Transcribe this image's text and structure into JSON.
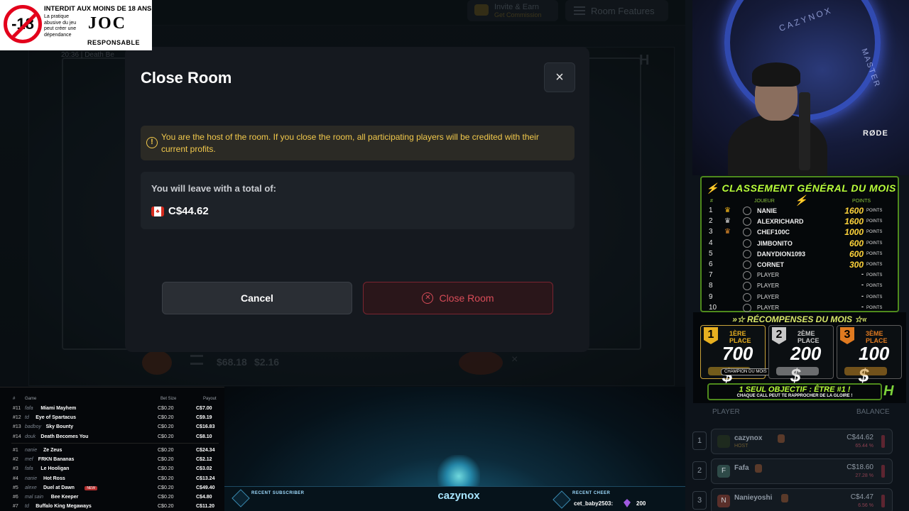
{
  "topbar": {
    "invite_label": "Invite & Earn",
    "invite_sub": "Get Commission",
    "features_label": "Room Features"
  },
  "game": {
    "time": "20:36",
    "title_partial": "Death Be",
    "balance": "$68.18",
    "bet": "$2.16"
  },
  "modal": {
    "title": "Close Room",
    "close_glyph": "×",
    "warning": "You are the host of the room. If you close the room, all participating players will be credited with their current profits.",
    "total_label": "You will leave with a total of:",
    "total_value": "C$44.62",
    "cancel_label": "Cancel",
    "confirm_label": "Close Room"
  },
  "age_banner": {
    "title": "INTERDIT AUX MOINS DE 18 ANS",
    "badge": "-18",
    "desc": "La pratique abusive du jeu peut créer une dépendance",
    "logo": "JOC",
    "logo_sub": "RESPONSABLE"
  },
  "webcam": {
    "brand": "CAZYNOX",
    "brand2": "MASTER",
    "mic_brand": "RØDE"
  },
  "leaderboard": {
    "title": "CLASSEMENT GÉNÉRAL DU MOIS",
    "col_rank": "#",
    "col_player": "JOUEUR",
    "col_points": "POINTS",
    "points_label": "POINTS",
    "rows": [
      {
        "rank": "1",
        "name": "NANIE",
        "points": "1600",
        "crown": "gold"
      },
      {
        "rank": "2",
        "name": "ALEXRICHARD",
        "points": "1600",
        "crown": "silver"
      },
      {
        "rank": "3",
        "name": "CHEF100C",
        "points": "1000",
        "crown": "bronze"
      },
      {
        "rank": "4",
        "name": "JIMBONITO",
        "points": "600",
        "crown": ""
      },
      {
        "rank": "5",
        "name": "DANYDION1093",
        "points": "600",
        "crown": ""
      },
      {
        "rank": "6",
        "name": "CORNET",
        "points": "300",
        "crown": ""
      },
      {
        "rank": "7",
        "name": "PLAYER",
        "points": "-",
        "crown": ""
      },
      {
        "rank": "8",
        "name": "PLAYER",
        "points": "-",
        "crown": ""
      },
      {
        "rank": "9",
        "name": "PLAYER",
        "points": "-",
        "crown": ""
      },
      {
        "rank": "10",
        "name": "PLAYER",
        "points": "-",
        "crown": ""
      }
    ]
  },
  "rewards": {
    "title": "RÉCOMPENSES DU MOIS",
    "prizes": [
      {
        "num": "1",
        "place": "1ÈRE PLACE",
        "amount": "700 $",
        "color": "#e8b020"
      },
      {
        "num": "2",
        "place": "2ÈME PLACE",
        "amount": "200 $",
        "color": "#c8c8c8"
      },
      {
        "num": "3",
        "place": "3ÈME PLACE",
        "amount": "100 $",
        "color": "#e07a20"
      }
    ],
    "champion": "CHAMPION DU MOIS",
    "objective": "1 SEUL OBJECTIF : ÊTRE #1 !",
    "objective_sub": "CHAQUE CALL PEUT TE RAPPROCHER DE LA GLOIRE !",
    "logo": "H"
  },
  "players": {
    "col_player": "PLAYER",
    "col_balance": "BALANCE",
    "rows": [
      {
        "rank": "1",
        "avatar": "",
        "name": "cazynox",
        "role": "HOST",
        "balance": "C$44.62",
        "pct": "65.44 %",
        "av_color": "#1e2a1e"
      },
      {
        "rank": "2",
        "avatar": "F",
        "name": "Fafa",
        "role": "",
        "balance": "C$18.60",
        "pct": "27.28 %",
        "av_color": "#2e4a48"
      },
      {
        "rank": "3",
        "avatar": "N",
        "name": "Nanieyoshi",
        "role": "",
        "balance": "C$4.47",
        "pct": "6.56 %",
        "av_color": "#5a2f2a"
      }
    ]
  },
  "history": {
    "col_num": "#",
    "col_game": "Game",
    "col_bet": "Bet Size",
    "col_payout": "Payout",
    "new_tag": "NEW",
    "rows_top": [
      {
        "n": "#11",
        "user": "fafa",
        "game": "Miami Mayhem",
        "bet": "C$0.20",
        "payout": "C$7.00"
      },
      {
        "n": "#12",
        "user": "td",
        "game": "Eye of Spartacus",
        "bet": "C$0.20",
        "payout": "C$9.19"
      },
      {
        "n": "#13",
        "user": "badboy",
        "game": "Sky Bounty",
        "bet": "C$0.20",
        "payout": "C$16.83"
      },
      {
        "n": "#14",
        "user": "douk",
        "game": "Death Becomes You",
        "bet": "C$0.20",
        "payout": "C$8.10"
      }
    ],
    "rows_bottom": [
      {
        "n": "#1",
        "user": "nanie",
        "game": "Ze Zeus",
        "bet": "C$0.20",
        "payout": "C$24.34"
      },
      {
        "n": "#2",
        "user": "mef",
        "game": "FRKN Bananas",
        "bet": "C$0.20",
        "payout": "C$2.12"
      },
      {
        "n": "#3",
        "user": "fafa",
        "game": "Le Hooligan",
        "bet": "C$0.20",
        "payout": "C$3.02"
      },
      {
        "n": "#4",
        "user": "nanie",
        "game": "Hot Ross",
        "bet": "C$0.20",
        "payout": "C$13.24"
      },
      {
        "n": "#5",
        "user": "alexe",
        "game": "Duel at Dawn",
        "bet": "C$0.20",
        "payout": "C$49.40"
      },
      {
        "n": "#6",
        "user": "mal sain",
        "game": "Bee Keeper",
        "bet": "C$0.20",
        "payout": "C$4.80"
      },
      {
        "n": "#7",
        "user": "td",
        "game": "Buffalo King Megaways",
        "bet": "C$0.20",
        "payout": "C$11.20"
      }
    ]
  },
  "stream_bar": {
    "sub_label": "RECENT SUBSCRIBER",
    "cheer_label": "RECENT CHEER",
    "channel": "cazynox",
    "cheer_user": "cet_baby2503:",
    "cheer_amount": "200"
  },
  "colors": {
    "accent_danger": "#d84c58",
    "warning": "#f2c94c",
    "leaderboard_green": "#b9ff3a"
  }
}
